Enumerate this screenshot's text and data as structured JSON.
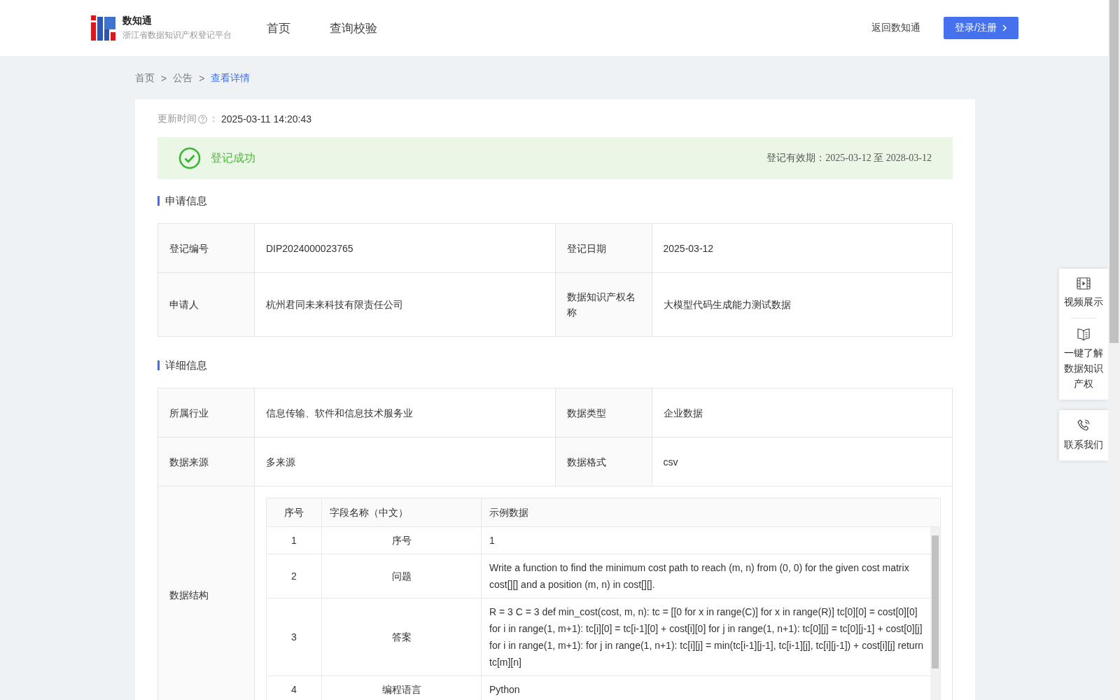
{
  "header": {
    "brand": "数知通",
    "subtitle": "浙江省数据知识产权登记平台",
    "nav": [
      {
        "label": "首页",
        "selected": false
      },
      {
        "label": "查询校验",
        "selected": false
      }
    ],
    "back_link": "返回数知通",
    "login_button": "登录/注册"
  },
  "breadcrumb": [
    {
      "label": "首页",
      "kind": "link"
    },
    {
      "label": ">",
      "kind": "separator"
    },
    {
      "label": "公告",
      "kind": "link"
    },
    {
      "label": ">",
      "kind": "separator"
    },
    {
      "label": "查看详情",
      "kind": "current"
    }
  ],
  "update": {
    "label": "更新时间",
    "colon": "：",
    "value": "2025-03-11 14:20:43"
  },
  "status": {
    "text": "登记成功",
    "validity": "登记有效期：2025-03-12 至 2028-03-12"
  },
  "application_info": {
    "title": "申请信息",
    "rows": [
      [
        "登记编号",
        "DIP2024000023765",
        "登记日期",
        "2025-03-12"
      ],
      [
        "申请人",
        "杭州君同未来科技有限责任公司",
        "数据知识产权名称",
        "大模型代码生成能力测试数据"
      ]
    ]
  },
  "detail_info": {
    "title": "详细信息",
    "rows": [
      [
        "所属行业",
        "信息传输、软件和信息技术服务业",
        "数据类型",
        "企业数据"
      ],
      [
        "数据来源",
        "多来源",
        "数据格式",
        "csv"
      ]
    ],
    "structure": {
      "label": "数据结构",
      "columns": [
        "序号",
        "字段名称（中文）",
        "示例数据"
      ],
      "rows": [
        [
          "1",
          "序号",
          "1"
        ],
        [
          "2",
          "问题",
          "Write a function to find the minimum cost path to reach (m, n) from (0, 0) for the given cost matrix cost[][] and a position (m, n) in cost[][]."
        ],
        [
          "3",
          "答案",
          "R = 3 C = 3 def min_cost(cost, m, n): tc = [[0 for x in range(C)] for x in range(R)] tc[0][0] = cost[0][0] for i in range(1, m+1): tc[i][0] = tc[i-1][0] + cost[i][0] for j in range(1, n+1): tc[0][j] = tc[0][j-1] + cost[0][j] for i in range(1, m+1): for j in range(1, n+1): tc[i][j] = min(tc[i-1][j-1], tc[i-1][j], tc[i][j-1]) + cost[i][j] return tc[m][n]"
        ],
        [
          "4",
          "编程语言",
          "Python"
        ]
      ]
    }
  },
  "side_panel": [
    {
      "label": "视频展示",
      "kind": "video"
    },
    {
      "label": "一键了解数据知识产权",
      "kind": "book"
    },
    {
      "label": "联系我们",
      "kind": "phone"
    }
  ]
}
